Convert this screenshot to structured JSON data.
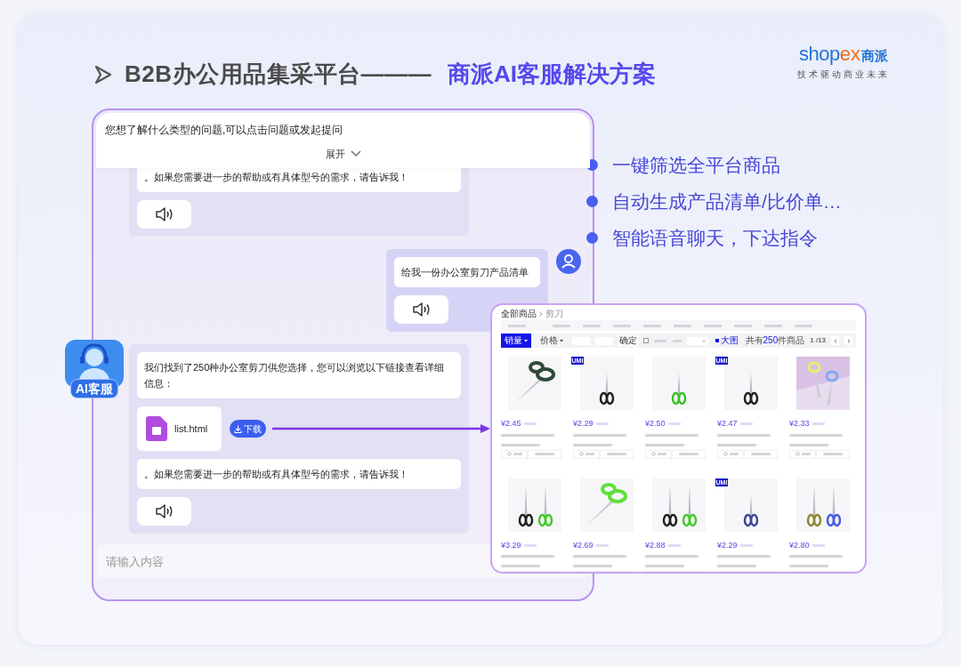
{
  "title": {
    "prefix": "B2B办公用品集采平台———",
    "highlight": "商派AI客服解决方案"
  },
  "logo": {
    "wordmark_main": "shop",
    "wordmark_accent": "ex",
    "wordmark_cn": "商派",
    "tagline": "技术驱动商业未来"
  },
  "chat": {
    "header_prompt": "您想了解什么类型的问题,可以点击问题或发起提问",
    "expand_label": "展开",
    "messages": [
      {
        "kind": "bot",
        "parts": [
          {
            "kind": "text",
            "text": "。如果您需要进一步的帮助或有具体型号的需求，请告诉我！"
          },
          {
            "kind": "audio"
          }
        ]
      },
      {
        "kind": "user",
        "parts": [
          {
            "kind": "text",
            "text": "给我一份办公室剪刀产品清单"
          },
          {
            "kind": "audio"
          }
        ]
      },
      {
        "kind": "bot",
        "parts": [
          {
            "kind": "text",
            "text": "我们找到了250种办公室剪刀供您选择，您可以浏览以下链接查看详细信息："
          },
          {
            "kind": "file",
            "name": "list.html",
            "button": "下载"
          },
          {
            "kind": "text",
            "text": "。如果您需要进一步的帮助或有具体型号的需求，请告诉我！"
          },
          {
            "kind": "audio"
          }
        ]
      }
    ],
    "input_placeholder": "请输入内容"
  },
  "avatar": {
    "label": "AI客服"
  },
  "features": [
    "一键筛选全平台商品",
    "自动生成产品清单/比价单…",
    "智能语音聊天，下达指令"
  ],
  "store": {
    "breadcrumb": [
      "全部商品",
      "剪刀"
    ],
    "sorts": [
      {
        "label": "销量",
        "selected": true
      },
      {
        "label": "价格",
        "selected": false
      }
    ],
    "confirm": "确定",
    "in_stock": {
      "checked": false
    },
    "view": {
      "label": "大图",
      "selected": true
    },
    "count_prefix": "共有",
    "count": "250",
    "count_suffix": "件商品",
    "page": "1 /13",
    "products": [
      {
        "price": "¥2.45"
      },
      {
        "badge": "UMI",
        "price": "¥2.29"
      },
      {
        "price": "¥2.50"
      },
      {
        "badge": "UMI",
        "price": "¥2.47"
      },
      {
        "price": "¥2.33"
      },
      {
        "price": "¥3.29"
      },
      {
        "price": "¥2.69"
      },
      {
        "price": "¥2.88"
      },
      {
        "badge": "UMI",
        "price": "¥2.29"
      },
      {
        "price": "¥2.80"
      }
    ]
  }
}
